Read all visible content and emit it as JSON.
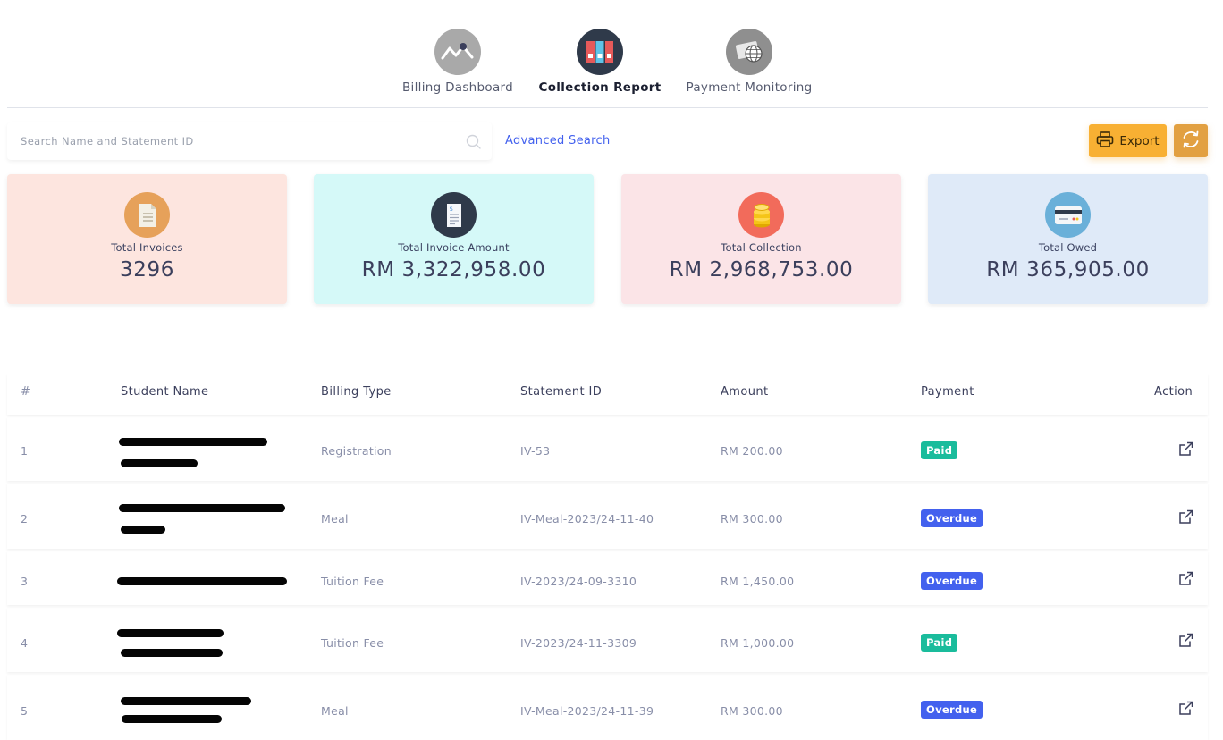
{
  "nav": {
    "tabs": [
      {
        "label": "Billing Dashboard",
        "icon": "chart-line-icon",
        "active": false
      },
      {
        "label": "Collection Report",
        "icon": "binders-icon",
        "active": true
      },
      {
        "label": "Payment Monitoring",
        "icon": "payment-globe-icon",
        "active": false
      }
    ]
  },
  "search": {
    "placeholder": "Search Name and Statement ID",
    "value": "",
    "advanced_label": "Advanced Search"
  },
  "toolbar": {
    "export_label": "Export",
    "refresh_icon": "refresh-icon"
  },
  "stats": {
    "invoices": {
      "label": "Total Invoices",
      "value": "3296",
      "icon": "document-icon",
      "color": "#fde5df"
    },
    "amount": {
      "label": "Total Invoice Amount",
      "value": "RM 3,322,958.00",
      "icon": "invoice-icon",
      "color": "#d5f9f8"
    },
    "collection": {
      "label": "Total Collection",
      "value": "RM 2,968,753.00",
      "icon": "coins-icon",
      "color": "#fbe4e7"
    },
    "owed": {
      "label": "Total Owed",
      "value": "RM 365,905.00",
      "icon": "credit-card-icon",
      "color": "#dfeaf8"
    }
  },
  "table": {
    "headers": [
      "#",
      "Student Name",
      "Billing Type",
      "Statement ID",
      "Amount",
      "Payment",
      "Action"
    ],
    "rows": [
      {
        "index": "1",
        "billing_type": "Registration",
        "statement_id": "IV-53",
        "amount": "RM 200.00",
        "payment": "Paid"
      },
      {
        "index": "2",
        "billing_type": "Meal",
        "statement_id": "IV-Meal-2023/24-11-40",
        "amount": "RM 300.00",
        "payment": "Overdue"
      },
      {
        "index": "3",
        "billing_type": "Tuition Fee",
        "statement_id": "IV-2023/24-09-3310",
        "amount": "RM 1,450.00",
        "payment": "Overdue"
      },
      {
        "index": "4",
        "billing_type": "Tuition Fee",
        "statement_id": "IV-2023/24-11-3309",
        "amount": "RM 1,000.00",
        "payment": "Paid"
      },
      {
        "index": "5",
        "billing_type": "Meal",
        "statement_id": "IV-Meal-2023/24-11-39",
        "amount": "RM 300.00",
        "payment": "Overdue"
      }
    ]
  },
  "colors": {
    "accent": "#4361ee",
    "paid": "#1abc9c",
    "overdue": "#4361ee",
    "export": "#f8b033"
  }
}
